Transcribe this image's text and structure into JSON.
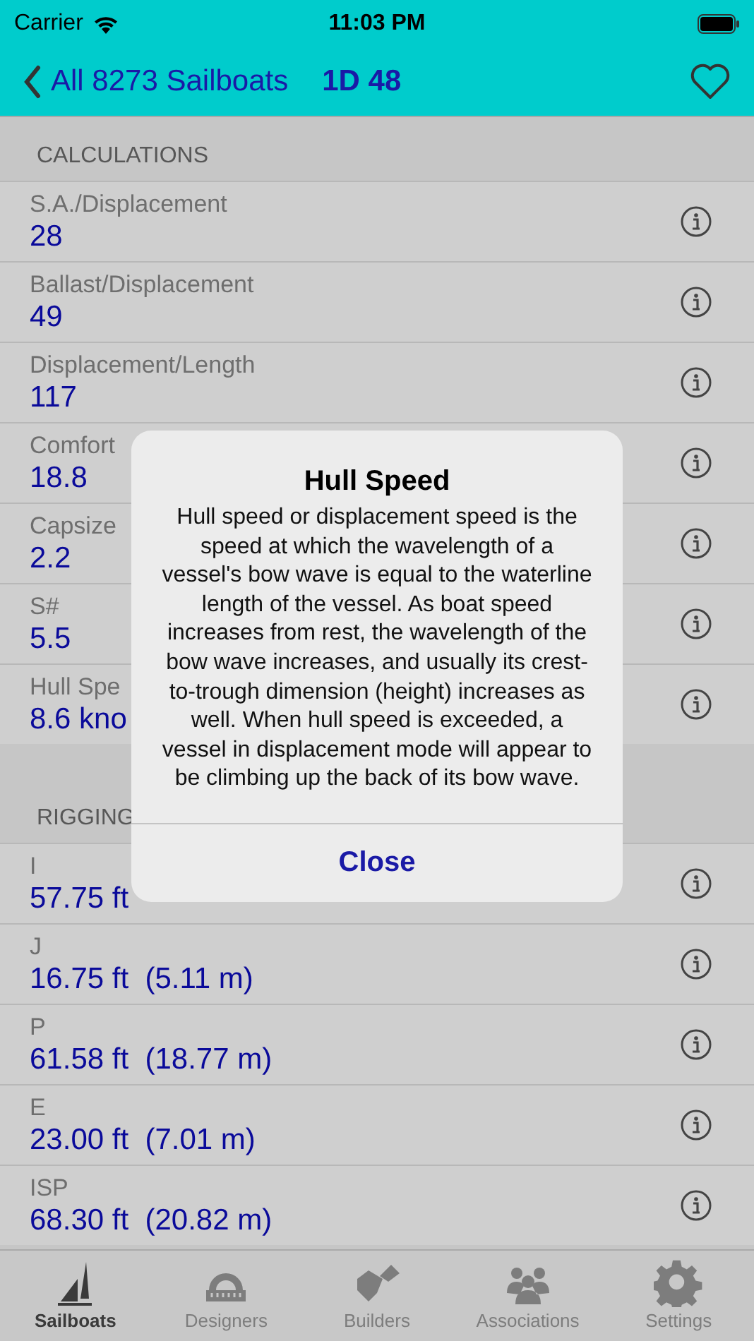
{
  "status_bar": {
    "carrier": "Carrier",
    "time": "11:03 PM"
  },
  "nav": {
    "back": "All 8273 Sailboats",
    "title": "1D 48",
    "favorite": false
  },
  "sections": [
    {
      "header": "CALCULATIONS",
      "rows": [
        {
          "label": "S.A./Displacement",
          "value": "28"
        },
        {
          "label": "Ballast/Displacement",
          "value": "49"
        },
        {
          "label": "Displacement/Length",
          "value": "117"
        },
        {
          "label": "Comfort",
          "value": "18.8"
        },
        {
          "label": "Capsize",
          "value": "2.2"
        },
        {
          "label": "S#",
          "value": "5.5"
        },
        {
          "label": "Hull Spe",
          "value": "8.6 kno"
        }
      ]
    },
    {
      "header": "RIGGING",
      "rows": [
        {
          "label": "I",
          "value": "57.75 ft"
        },
        {
          "label": "J",
          "value": "16.75 ft  (5.11 m)"
        },
        {
          "label": "P",
          "value": "61.58 ft  (18.77 m)"
        },
        {
          "label": "E",
          "value": "23.00 ft  (7.01 m)"
        },
        {
          "label": "ISP",
          "value": "68.30 ft  (20.82 m)"
        }
      ]
    }
  ],
  "alert": {
    "title": "Hull Speed",
    "message": "Hull speed or displacement speed is the speed at which the wavelength of a vessel's bow wave is equal to the waterline length of the vessel. As boat speed increases from rest, the wavelength of the bow wave increases, and usually its crest-to-trough dimension (height) increases as well. When hull speed is exceeded, a vessel in displacement mode will appear to be climbing up the back of its bow wave.",
    "button": "Close"
  },
  "tabs": [
    {
      "label": "Sailboats",
      "selected": true
    },
    {
      "label": "Designers",
      "selected": false
    },
    {
      "label": "Builders",
      "selected": false
    },
    {
      "label": "Associations",
      "selected": false
    },
    {
      "label": "Settings",
      "selected": false
    }
  ]
}
